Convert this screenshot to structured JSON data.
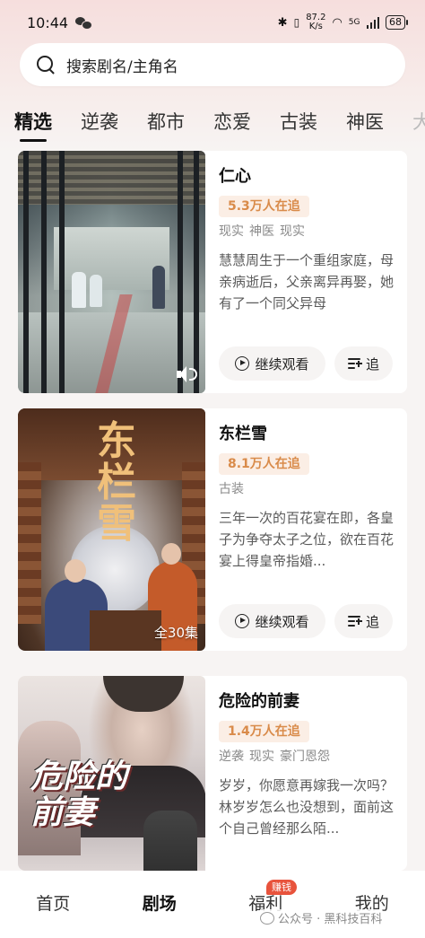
{
  "status_bar": {
    "time": "10:44",
    "speed_value": "87.2",
    "speed_unit": "K/s",
    "network": "5G",
    "battery": "68"
  },
  "search": {
    "placeholder": "搜索剧名/主角名"
  },
  "tabs": [
    {
      "label": "精选",
      "active": true
    },
    {
      "label": "逆袭"
    },
    {
      "label": "都市"
    },
    {
      "label": "恋爱"
    },
    {
      "label": "古装"
    },
    {
      "label": "神医"
    },
    {
      "label": "大"
    }
  ],
  "dramas": [
    {
      "title": "仁心",
      "followers": "5.3万人在追",
      "tags": [
        "现实",
        "神医",
        "现实"
      ],
      "description": "慧慧周生于一个重组家庭，母亲病逝后，父亲离异再娶，她有了一个同父异母",
      "watch_label": "继续观看",
      "follow_label": "追",
      "poster_overlay": ""
    },
    {
      "title": "东栏雪",
      "followers": "8.1万人在追",
      "tags": [
        "古装"
      ],
      "description": "三年一次的百花宴在即，各皇子为争夺太子之位，欲在百花宴上得皇帝指婚...",
      "watch_label": "继续观看",
      "follow_label": "追",
      "poster_overlay": "全30集",
      "poster_title": "东栏雪"
    },
    {
      "title": "危险的前妻",
      "followers": "1.4万人在追",
      "tags": [
        "逆袭",
        "现实",
        "豪门恩怨"
      ],
      "description": "岁岁，你愿意再嫁我一次吗？林岁岁怎么也没想到，面前这个自己曾经那么陌...",
      "watch_label": "继续观看",
      "follow_label": "追",
      "poster_title": "危险的前妻"
    }
  ],
  "bottom_nav": [
    {
      "label": "首页"
    },
    {
      "label": "剧场",
      "active": true
    },
    {
      "label": "福利",
      "badge": "赚钱"
    },
    {
      "label": "我的"
    }
  ],
  "watermark": "公众号 · 黑科技百科",
  "colors": {
    "heat_bg": "#fbeee5",
    "heat_text": "#d98b4a",
    "badge": "#e8533c"
  }
}
